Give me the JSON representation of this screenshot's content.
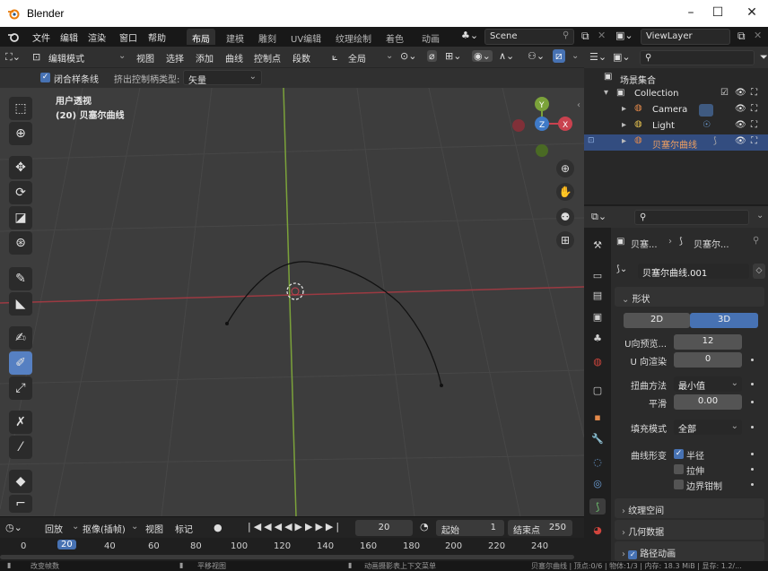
{
  "window": {
    "title": "Blender",
    "controls": [
      "–",
      "☐",
      "✕"
    ]
  },
  "menu": {
    "items": [
      "文件",
      "编辑",
      "渲染",
      "窗口",
      "帮助"
    ],
    "workspaces": [
      "布局",
      "建模",
      "雕刻",
      "UV编辑",
      "纹理绘制",
      "着色",
      "动画"
    ],
    "active_workspace": "布局",
    "scene": "Scene",
    "view_layer": "ViewLayer"
  },
  "viewport": {
    "mode": "编辑模式",
    "menus": [
      "视图",
      "选择",
      "添加",
      "曲线",
      "控制点",
      "段数"
    ],
    "transform_orientation": "全局",
    "toolset": {
      "closed_spline": "闭合样条线",
      "extrude_type_label": "挤出控制柄类型:",
      "extrude_type_value": "矢量"
    },
    "overlay_title": "用户透视",
    "overlay_object": "(20) 贝塞尔曲线",
    "gizmo": {
      "y": "Y",
      "z": "Z",
      "x": "X"
    }
  },
  "timeline": {
    "menus": [
      "回放",
      "抠像(插帧)",
      "视图",
      "标记"
    ],
    "current_frame": "20",
    "start_label": "起始",
    "start": "1",
    "end_label": "结束点",
    "end": "250",
    "ticks": [
      "0",
      "20",
      "40",
      "60",
      "80",
      "100",
      "120",
      "140",
      "160",
      "180",
      "200",
      "220",
      "240"
    ]
  },
  "status": {
    "left": "改变帧数",
    "mid1": "平移视图",
    "mid2": "动画摄影表上下文菜单",
    "right": "贝塞尔曲线 | 顶点:0/6 | 物体:1/3 | 内存: 18.3 MiB | 显存: 1.2/..."
  },
  "outliner": {
    "root": "场景集合",
    "collection": "Collection",
    "items": [
      {
        "name": "Camera",
        "color": "#e58a4a"
      },
      {
        "name": "Light",
        "color": "#e8c450"
      },
      {
        "name": "贝塞尔曲线",
        "color": "#e58a4a"
      }
    ]
  },
  "properties": {
    "breadcrumb_a": "贝塞...",
    "breadcrumb_b": "贝塞尔...",
    "datablock": "贝塞尔曲线.001",
    "shape_panel": "形状",
    "dim_2d": "2D",
    "dim_3d": "3D",
    "u_preview_label": "U向预览...",
    "u_preview": "12",
    "u_render_label": "U 向渲染",
    "u_render": "0",
    "twist_method_label": "扭曲方法",
    "twist_method": "最小值",
    "smooth_label": "平滑",
    "smooth": "0.00",
    "fill_mode_label": "填充模式",
    "fill_mode": "全部",
    "curve_deform_label": "曲线形变",
    "opt_radius": "半径",
    "opt_stretch": "拉伸",
    "opt_bounds": "边界钳制",
    "texture_space": "纹理空间",
    "geometry": "几何数据",
    "path_anim": "路径动画"
  },
  "colors": {
    "accent": "#4772b3",
    "selected": "#334d80",
    "x_axis": "#c9424f",
    "y_axis": "#7ba23a",
    "z_axis": "#3f7ac7"
  }
}
